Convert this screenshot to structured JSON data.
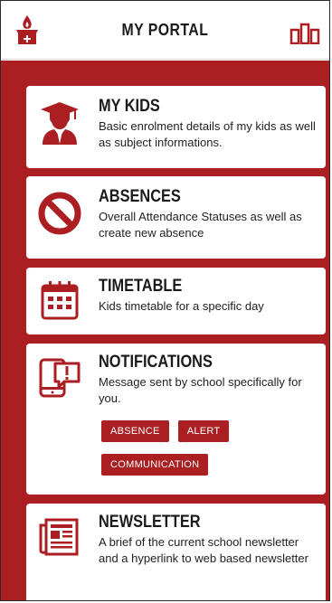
{
  "header": {
    "title": "MY PORTAL",
    "logo_icon": "candle-logo-icon",
    "right_icon": "bar-chart-icon"
  },
  "colors": {
    "accent": "#ab1f23",
    "card": "#ffffff"
  },
  "cards": [
    {
      "title": "MY KIDS",
      "description": "Basic enrolment details of my kids as well as subject informations.",
      "icon": "graduate-icon"
    },
    {
      "title": "ABSENCES",
      "description": "Overall Attendance Statuses as well as create new absence",
      "icon": "prohibited-icon"
    },
    {
      "title": "TIMETABLE",
      "description": "Kids timetable for a specific day",
      "icon": "calendar-icon"
    },
    {
      "title": "NOTIFICATIONS",
      "description": "Message sent by school specifically for you.",
      "icon": "phone-alert-icon",
      "tags": [
        "ABSENCE",
        "ALERT",
        "COMMUNICATION"
      ]
    },
    {
      "title": "NEWSLETTER",
      "description": "A brief of the current school newsletter and a hyperlink to web based newsletter",
      "icon": "newspaper-icon"
    }
  ]
}
